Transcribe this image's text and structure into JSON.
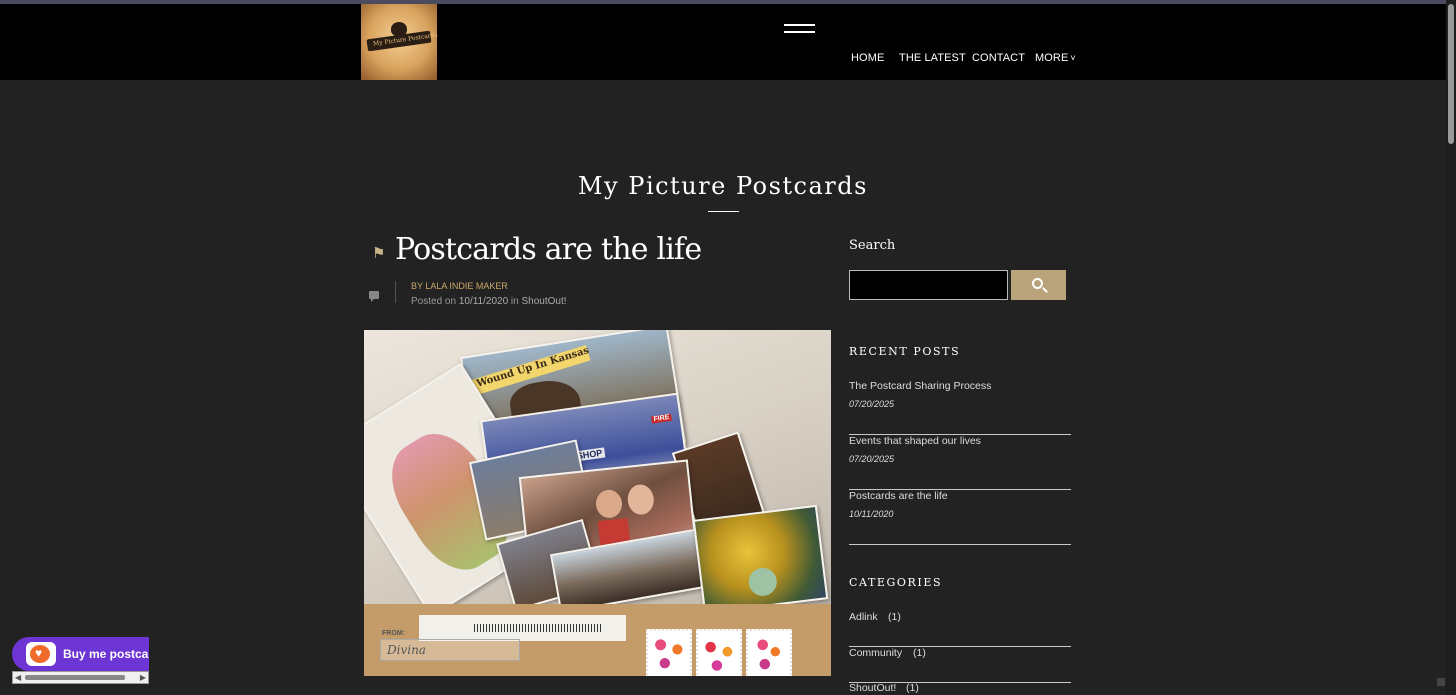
{
  "header": {
    "logo_text": "My Picture Postcards",
    "nav": [
      {
        "label": "HOME"
      },
      {
        "label": "THE LATEST"
      },
      {
        "label": "CONTACT"
      },
      {
        "label": "MORE"
      }
    ],
    "more_chevron": "˅"
  },
  "site": {
    "title": "My Picture Postcards"
  },
  "post": {
    "title": "Postcards are the life",
    "author": "BY LALA INDIE MAKER",
    "posted_prefix": "Posted on",
    "date": "10/11/2020",
    "in_prefix": "in",
    "category": "ShoutOut!",
    "icon": "postcard-flag-icon",
    "image_texts": {
      "banner": "Wound Up In Kansas",
      "shop": "RICO SHOP",
      "fire": "FIRE",
      "from": "FROM:",
      "signature": "Divina"
    }
  },
  "sidebar": {
    "search_heading": "Search",
    "search_value": "",
    "recent_heading": "RECENT POSTS",
    "recent_posts": [
      {
        "title": "The Postcard Sharing Process",
        "date": "07/20/2025"
      },
      {
        "title": "Events that shaped our lives",
        "date": "07/20/2025"
      },
      {
        "title": "Postcards are the life",
        "date": "10/11/2020"
      }
    ],
    "categories_heading": "CATEGORIES",
    "categories": [
      {
        "name": "Adlink",
        "count": "(1)"
      },
      {
        "name": "Community",
        "count": "(1)"
      },
      {
        "name": "ShoutOut!",
        "count": "(1)"
      }
    ]
  },
  "widget": {
    "buy_label": "Buy me postcards"
  },
  "colors": {
    "background": "#222222",
    "header": "#000000",
    "accent_gold": "#b9a37a",
    "byline": "#c9a86a",
    "widget_purple": "#6d35d3"
  }
}
